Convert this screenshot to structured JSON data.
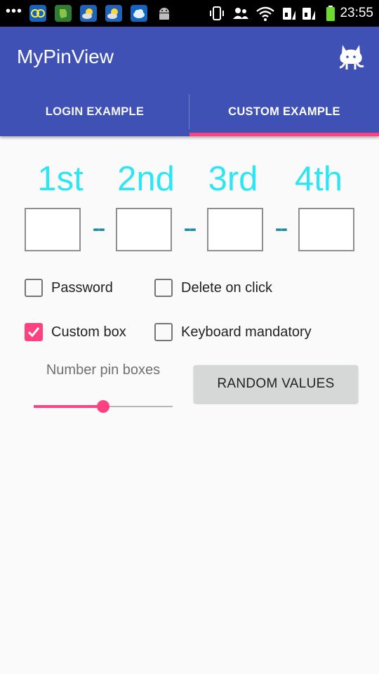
{
  "status_bar": {
    "overflow_dots": "•••",
    "time": "23:55",
    "left_icons": [
      "nfc-app-icon",
      "evernote-app-icon",
      "weather-app-icon",
      "weather-app-icon",
      "cloud-app-icon",
      "android-icon"
    ],
    "right_icons": [
      "vibrate-icon",
      "contacts-icon",
      "wifi-icon",
      "sim1-signal-icon",
      "sim2-signal-icon",
      "battery-icon"
    ]
  },
  "app_bar": {
    "title": "MyPinView",
    "action_icon": "github-octocat-icon",
    "color": "#3f51b5"
  },
  "tabs": [
    {
      "label": "LOGIN EXAMPLE",
      "selected": false
    },
    {
      "label": "CUSTOM EXAMPLE",
      "selected": true
    }
  ],
  "accent_color": "#ff4081",
  "pin_view": {
    "ordinals": [
      "1st",
      "2nd",
      "3rd",
      "4th"
    ],
    "boxes": [
      "",
      "",
      "",
      ""
    ],
    "separator": "--",
    "ordinal_color": "#2ee6f3",
    "separator_color": "#1a8ca3"
  },
  "options": [
    {
      "label": "Password",
      "checked": false
    },
    {
      "label": "Delete on click",
      "checked": false
    },
    {
      "label": "Custom box",
      "checked": true
    },
    {
      "label": "Keyboard mandatory",
      "checked": false
    }
  ],
  "slider": {
    "label": "Number pin boxes",
    "fraction": 0.5
  },
  "random_button": {
    "label": "RANDOM VALUES"
  }
}
